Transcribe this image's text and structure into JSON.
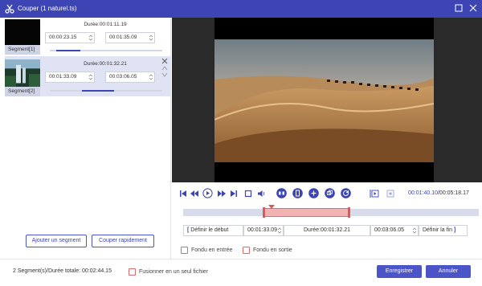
{
  "window": {
    "title": "Couper (1 naturel.ts)"
  },
  "segments": [
    {
      "label": "Segment[1]",
      "duration": "Durée:00:01:11.19",
      "start": "00:00:23.15",
      "end": "00:01:35.09"
    },
    {
      "label": "Segment[2]",
      "duration": "Durée:00:01:32.21",
      "start": "00:01:33.09",
      "end": "00:03:06.05"
    }
  ],
  "left_buttons": {
    "add_segment": "Ajouter un segment",
    "quick_split": "Couper rapidement"
  },
  "player": {
    "current_time": "00:01:40.10",
    "total_time": "/00:05:18.17"
  },
  "trim": {
    "set_start": "Définir le début",
    "start": "00:01:33.09",
    "duration": "Durée:00:01:32.21",
    "end": "00:03:06.05",
    "set_end": "Définir la fin"
  },
  "fades": {
    "fade_in": "Fondu en entrée",
    "fade_out": "Fondu en sortie"
  },
  "footer": {
    "summary": "2 Segment(s)/Durée totale: 00:02:44.15",
    "merge": "Fusionner en un seul fichier",
    "save": "Enregistrer",
    "cancel": "Annuler"
  },
  "colors": {
    "accent": "#3d45b5",
    "button": "#4b55c8",
    "selection": "#f3b3b3",
    "marker": "#e25555"
  }
}
